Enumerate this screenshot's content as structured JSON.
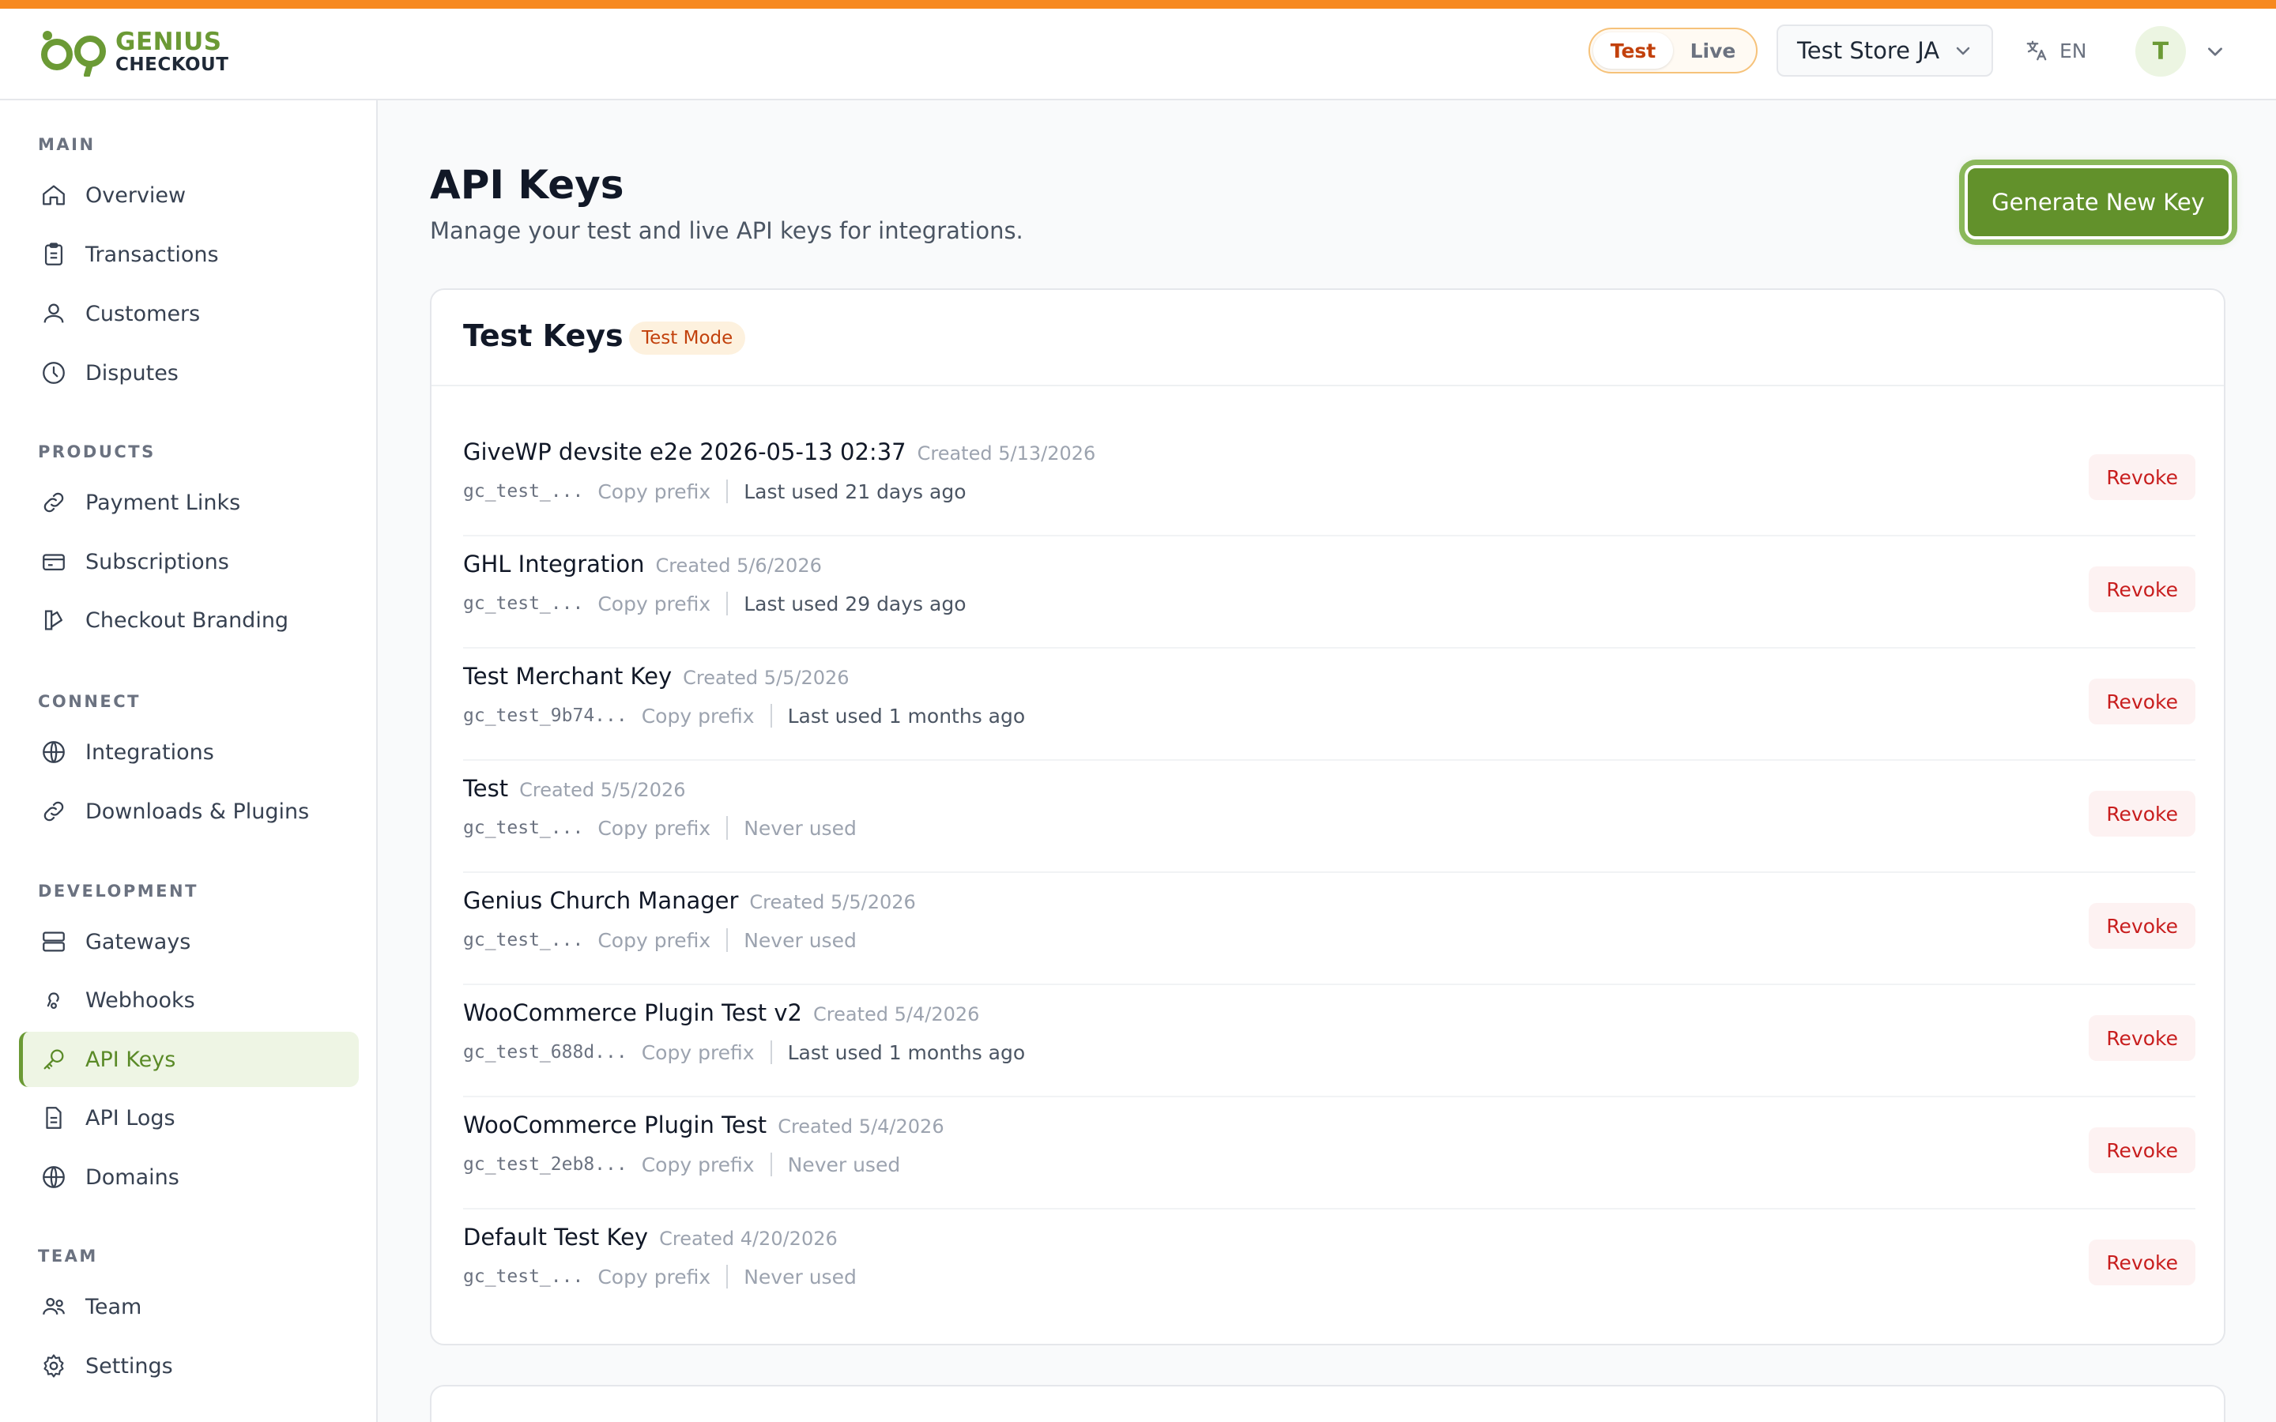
{
  "brand": {
    "name_line1": "GENIUS",
    "name_line2": "CHECKOUT",
    "accent": "#f7891f",
    "primary": "#62912b"
  },
  "header": {
    "mode_test": "Test",
    "mode_live": "Live",
    "active_mode": "Test",
    "store": "Test Store JA",
    "language": "EN",
    "avatar_initial": "T"
  },
  "sidebar": {
    "sections": [
      {
        "title": "MAIN",
        "items": [
          {
            "label": "Overview",
            "icon": "home-icon"
          },
          {
            "label": "Transactions",
            "icon": "clipboard-icon"
          },
          {
            "label": "Customers",
            "icon": "users-icon"
          },
          {
            "label": "Disputes",
            "icon": "clock-icon"
          }
        ]
      },
      {
        "title": "PRODUCTS",
        "items": [
          {
            "label": "Payment Links",
            "icon": "link-icon"
          },
          {
            "label": "Subscriptions",
            "icon": "credit-card-icon"
          },
          {
            "label": "Checkout Branding",
            "icon": "palette-icon"
          }
        ]
      },
      {
        "title": "CONNECT",
        "items": [
          {
            "label": "Integrations",
            "icon": "globe-icon"
          },
          {
            "label": "Downloads & Plugins",
            "icon": "link-icon"
          }
        ]
      },
      {
        "title": "DEVELOPMENT",
        "items": [
          {
            "label": "Gateways",
            "icon": "server-icon"
          },
          {
            "label": "Webhooks",
            "icon": "webhook-icon"
          },
          {
            "label": "API Keys",
            "icon": "key-icon",
            "active": true
          },
          {
            "label": "API Logs",
            "icon": "file-icon"
          },
          {
            "label": "Domains",
            "icon": "globe-icon"
          }
        ]
      },
      {
        "title": "TEAM",
        "items": [
          {
            "label": "Team",
            "icon": "team-icon"
          },
          {
            "label": "Settings",
            "icon": "gear-icon"
          }
        ]
      }
    ]
  },
  "page": {
    "title": "API Keys",
    "subtitle": "Manage your test and live API keys for integrations.",
    "generate_label": "Generate New Key"
  },
  "test_keys": {
    "title": "Test Keys",
    "badge": "Test Mode",
    "copy_label": "Copy prefix",
    "revoke_label": "Revoke",
    "rows": [
      {
        "name": "GiveWP devsite e2e 2026-05-13 02:37",
        "created": "Created 5/13/2026",
        "prefix": "gc_test_...",
        "last_used": "Last used 21 days ago"
      },
      {
        "name": "GHL Integration",
        "created": "Created 5/6/2026",
        "prefix": "gc_test_...",
        "last_used": "Last used 29 days ago"
      },
      {
        "name": "Test Merchant Key",
        "created": "Created 5/5/2026",
        "prefix": "gc_test_9b74...",
        "last_used": "Last used 1 months ago"
      },
      {
        "name": "Test",
        "created": "Created 5/5/2026",
        "prefix": "gc_test_...",
        "last_used": "Never used"
      },
      {
        "name": "Genius Church Manager",
        "created": "Created 5/5/2026",
        "prefix": "gc_test_...",
        "last_used": "Never used"
      },
      {
        "name": "WooCommerce Plugin Test v2",
        "created": "Created 5/4/2026",
        "prefix": "gc_test_688d...",
        "last_used": "Last used 1 months ago"
      },
      {
        "name": "WooCommerce Plugin Test",
        "created": "Created 5/4/2026",
        "prefix": "gc_test_2eb8...",
        "last_used": "Never used"
      },
      {
        "name": "Default Test Key",
        "created": "Created 4/20/2026",
        "prefix": "gc_test_...",
        "last_used": "Never used"
      }
    ]
  }
}
